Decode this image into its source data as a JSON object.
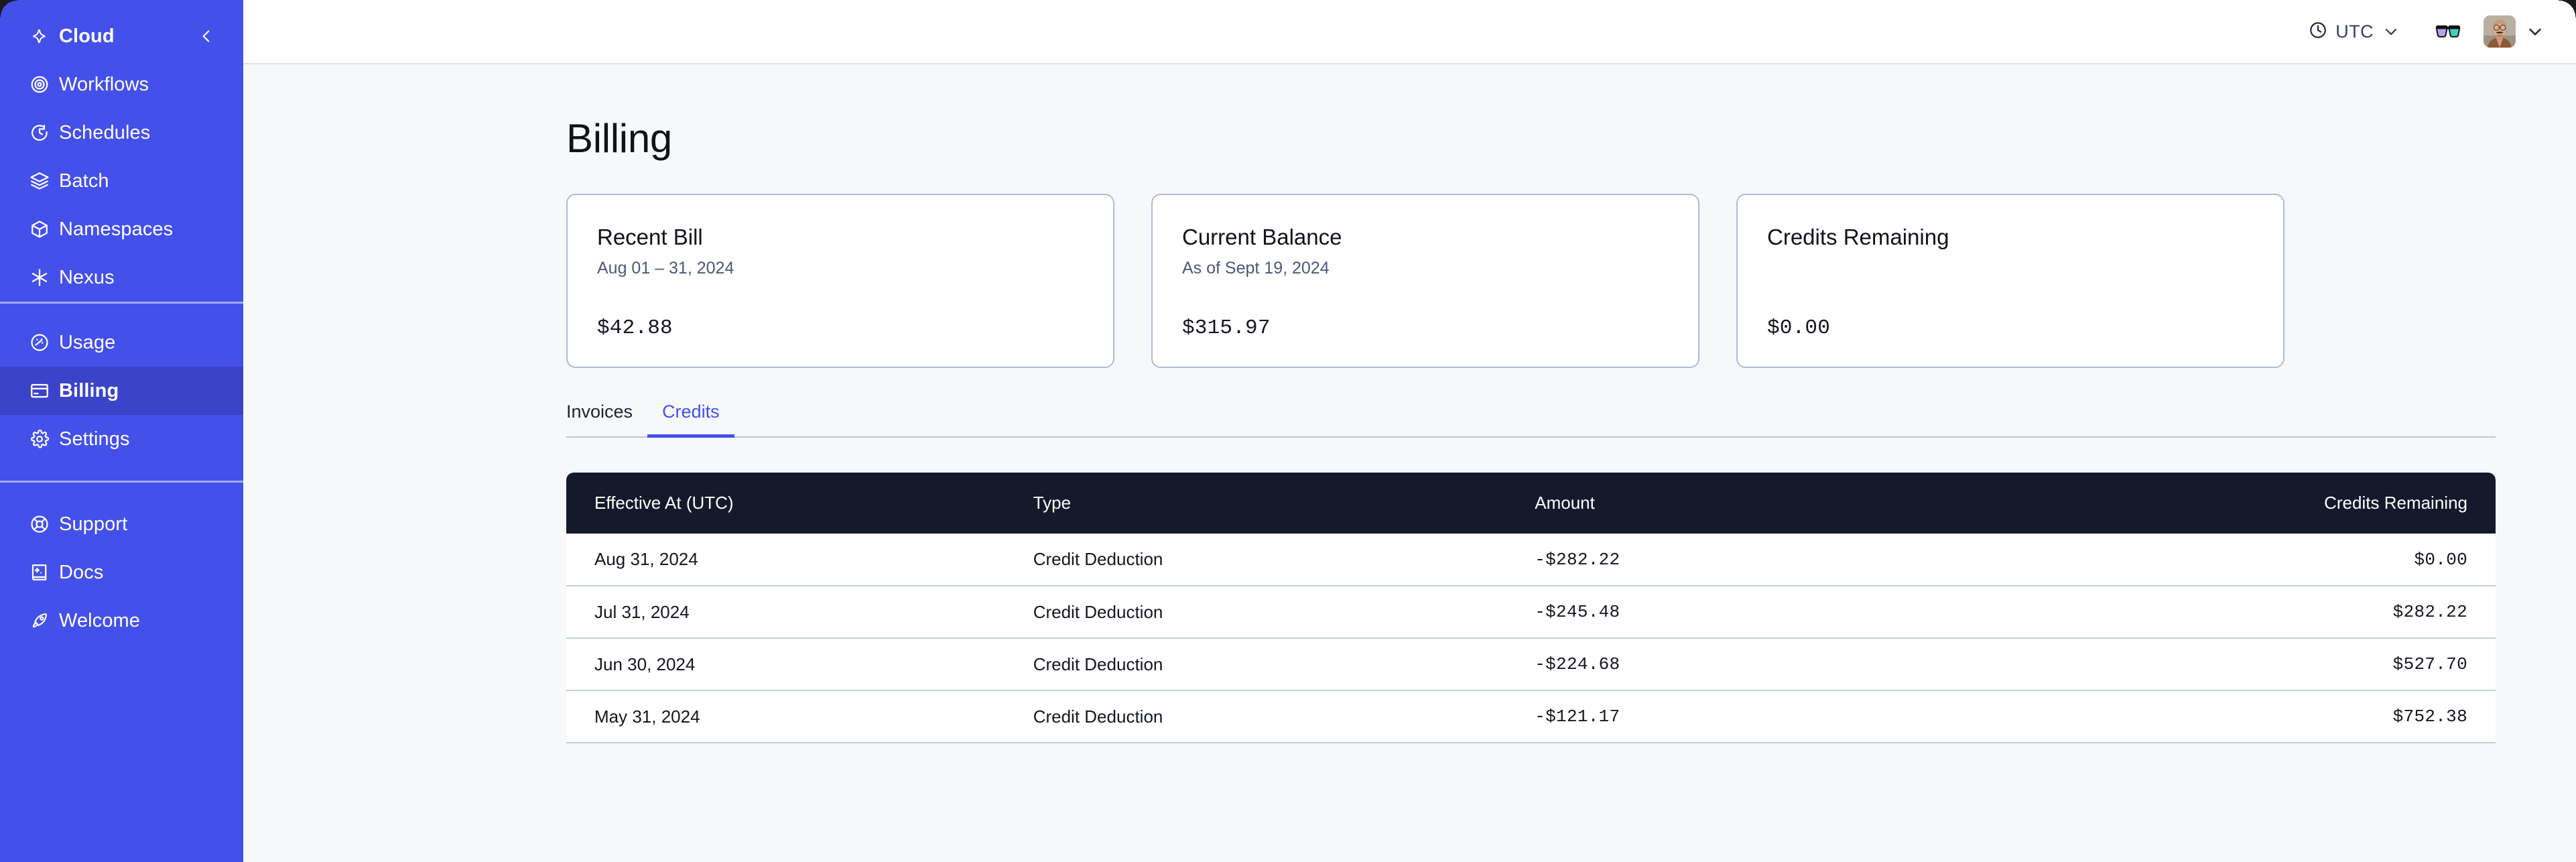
{
  "sidebar": {
    "brand": {
      "label": "Cloud",
      "icon": "cloud-star-icon",
      "collapse_icon": "chevron-left-icon"
    },
    "groups": [
      {
        "items": [
          {
            "label": "Workflows",
            "icon": "workflows-icon",
            "active": false
          },
          {
            "label": "Schedules",
            "icon": "schedules-icon",
            "active": false
          },
          {
            "label": "Batch",
            "icon": "batch-icon",
            "active": false
          },
          {
            "label": "Namespaces",
            "icon": "namespaces-icon",
            "active": false
          },
          {
            "label": "Nexus",
            "icon": "nexus-icon",
            "active": false
          }
        ]
      },
      {
        "items": [
          {
            "label": "Usage",
            "icon": "usage-icon",
            "active": false
          },
          {
            "label": "Billing",
            "icon": "billing-icon",
            "active": true
          },
          {
            "label": "Settings",
            "icon": "settings-icon",
            "active": false
          }
        ]
      },
      {
        "items": [
          {
            "label": "Support",
            "icon": "support-icon",
            "active": false
          },
          {
            "label": "Docs",
            "icon": "docs-icon",
            "active": false
          },
          {
            "label": "Welcome",
            "icon": "welcome-icon",
            "active": false
          }
        ]
      }
    ]
  },
  "topbar": {
    "timezone_label": "UTC",
    "timezone_icon": "clock-icon",
    "timezone_chevron_icon": "chevron-down-icon",
    "glasses_icon": "3d-glasses-icon",
    "avatar_icon": "user-avatar",
    "user_chevron_icon": "chevron-down-icon"
  },
  "page": {
    "title": "Billing"
  },
  "cards": [
    {
      "title": "Recent Bill",
      "subtitle": "Aug 01 – 31, 2024",
      "value": "$42.88"
    },
    {
      "title": "Current Balance",
      "subtitle": "As of Sept 19, 2024",
      "value": "$315.97"
    },
    {
      "title": "Credits Remaining",
      "subtitle": "",
      "value": "$0.00"
    }
  ],
  "tabs": [
    {
      "label": "Invoices",
      "active": false
    },
    {
      "label": "Credits",
      "active": true
    }
  ],
  "table": {
    "columns": [
      "Effective At (UTC)",
      "Type",
      "Amount",
      "Credits Remaining"
    ],
    "rows": [
      {
        "date": "Aug 31, 2024",
        "type": "Credit Deduction",
        "amount": "-$282.22",
        "remaining": "$0.00"
      },
      {
        "date": "Jul 31, 2024",
        "type": "Credit Deduction",
        "amount": "-$245.48",
        "remaining": "$282.22"
      },
      {
        "date": "Jun 30, 2024",
        "type": "Credit Deduction",
        "amount": "-$224.68",
        "remaining": "$527.70"
      },
      {
        "date": "May 31, 2024",
        "type": "Credit Deduction",
        "amount": "-$121.17",
        "remaining": "$752.38"
      }
    ]
  },
  "colors": {
    "sidebar_bg": "#4450ea",
    "sidebar_active_bg": "#3b43ca",
    "accent": "#4450ea",
    "page_bg": "#f7f8fa",
    "table_header_bg": "#141a2b",
    "card_border": "#aebcd5",
    "amount_text": "#5f7398"
  }
}
